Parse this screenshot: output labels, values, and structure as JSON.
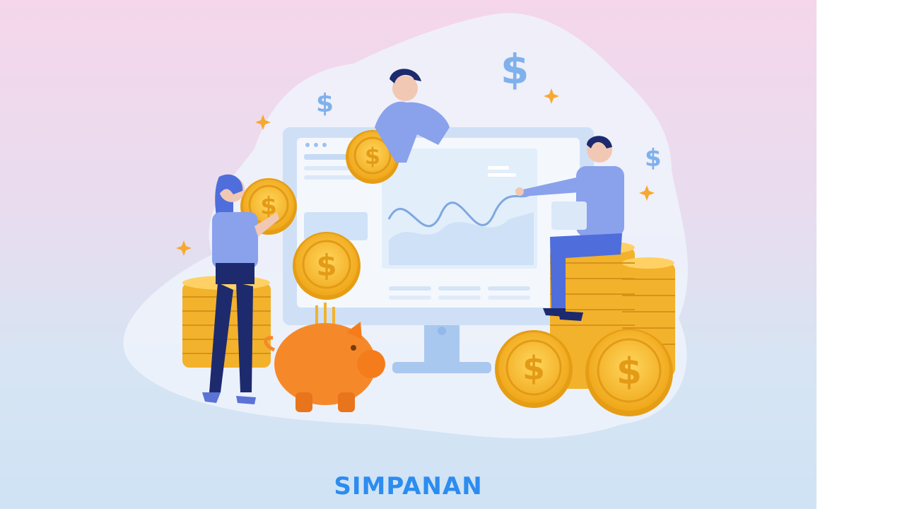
{
  "caption": "SIMPANAN",
  "coin_symbol": "$",
  "colors": {
    "caption": "#2c8cf0",
    "coin": "#f6b82b",
    "piggy": "#f5892a",
    "monitor": "#b9d4f2",
    "figure_shirt": "#7f93e6",
    "figure_pants": "#1d2a6e"
  },
  "icons": [
    "dollar-sign-icon",
    "sparkle-icon",
    "piggy-bank-icon",
    "coin-icon"
  ]
}
